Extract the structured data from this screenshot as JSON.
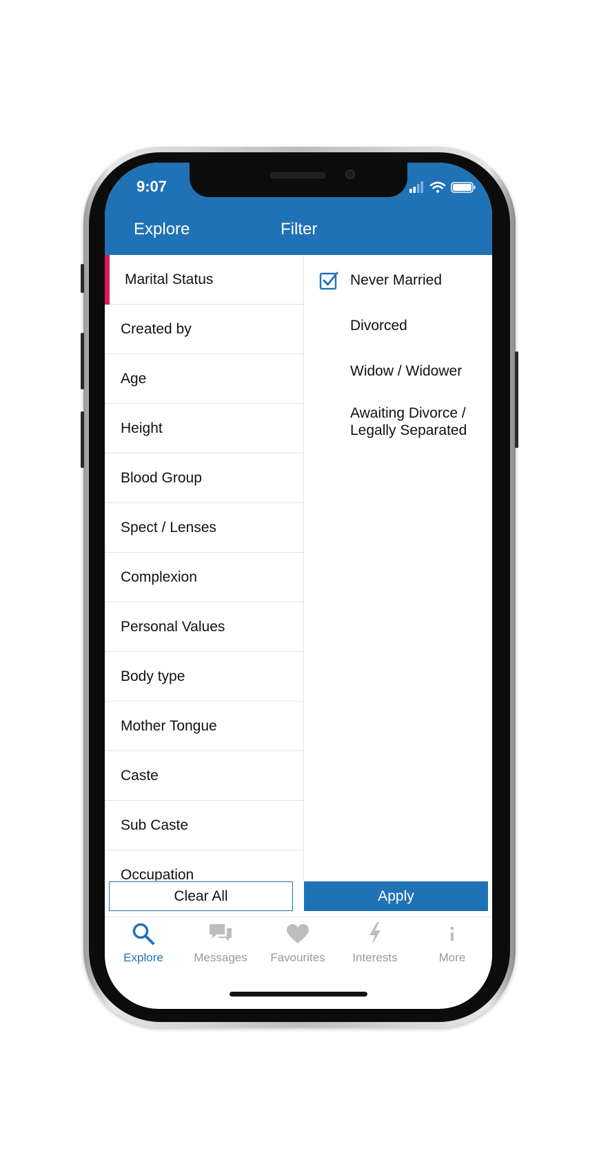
{
  "status_bar": {
    "time": "9:07"
  },
  "header": {
    "left_title": "Explore",
    "center_title": "Filter"
  },
  "left_menu": {
    "items": [
      {
        "label": "Marital Status",
        "active": true
      },
      {
        "label": "Created by"
      },
      {
        "label": "Age"
      },
      {
        "label": "Height"
      },
      {
        "label": "Blood Group"
      },
      {
        "label": "Spect / Lenses"
      },
      {
        "label": "Complexion"
      },
      {
        "label": "Personal Values"
      },
      {
        "label": "Body type"
      },
      {
        "label": "Mother Tongue"
      },
      {
        "label": "Caste"
      },
      {
        "label": "Sub Caste"
      },
      {
        "label": "Occupation"
      }
    ]
  },
  "options": {
    "items": [
      {
        "label": "Never Married",
        "checked": true
      },
      {
        "label": "Divorced",
        "checked": false
      },
      {
        "label": "Widow / Widower",
        "checked": false
      },
      {
        "label_line1": "Awaiting Divorce /",
        "label_line2": "Legally Separated",
        "checked": false
      }
    ]
  },
  "actions": {
    "clear_label": "Clear All",
    "apply_label": "Apply"
  },
  "tabbar": {
    "tabs": [
      {
        "label": "Explore",
        "icon": "search-icon",
        "active": true
      },
      {
        "label": "Messages",
        "icon": "chat-bubbles-icon"
      },
      {
        "label": "Favourites",
        "icon": "heart-icon"
      },
      {
        "label": "Interests",
        "icon": "lightning-icon"
      },
      {
        "label": "More",
        "icon": "info-icon"
      }
    ]
  },
  "colors": {
    "primary": "#1f72b6",
    "accent": "#d81b5e",
    "inactive": "#9a9a9a"
  }
}
